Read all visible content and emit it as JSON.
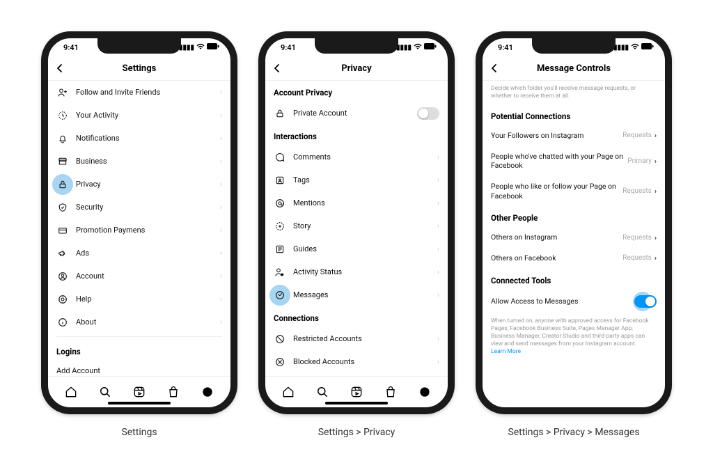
{
  "status": {
    "time": "9:41"
  },
  "phone1": {
    "title": "Settings",
    "items": [
      {
        "icon": "person-plus",
        "label": "Follow and Invite Friends"
      },
      {
        "icon": "clock",
        "label": "Your Activity"
      },
      {
        "icon": "bell",
        "label": "Notifications"
      },
      {
        "icon": "store",
        "label": "Business"
      },
      {
        "icon": "lock",
        "label": "Privacy",
        "highlight": true
      },
      {
        "icon": "shield",
        "label": "Security"
      },
      {
        "icon": "card",
        "label": "Promotion Paymens"
      },
      {
        "icon": "megaphone",
        "label": "Ads"
      },
      {
        "icon": "account",
        "label": "Account"
      },
      {
        "icon": "help",
        "label": "Help"
      },
      {
        "icon": "info",
        "label": "About"
      }
    ],
    "logins_header": "Logins",
    "add_account": "Add Account"
  },
  "phone2": {
    "title": "Privacy",
    "section1": "Account Privacy",
    "private_account": "Private Account",
    "section2": "Interactions",
    "items2": [
      {
        "icon": "comment",
        "label": "Comments"
      },
      {
        "icon": "tags",
        "label": "Tags"
      },
      {
        "icon": "mention",
        "label": "Mentions"
      },
      {
        "icon": "story",
        "label": "Story"
      },
      {
        "icon": "guides",
        "label": "Guides"
      },
      {
        "icon": "activity",
        "label": "Activity Status"
      },
      {
        "icon": "messages",
        "label": "Messages",
        "highlight": true
      }
    ],
    "section3": "Connections",
    "items3": [
      {
        "icon": "restricted",
        "label": "Restricted Accounts"
      },
      {
        "icon": "blocked",
        "label": "Blocked Accounts"
      }
    ]
  },
  "phone3": {
    "title": "Message Controls",
    "top_desc": "Decide which folder you'll receive message requests, or whether to receive them at all.",
    "sectionA": "Potential Connections",
    "rowsA": [
      {
        "label": "Your Followers on Instagram",
        "value": "Requests"
      },
      {
        "label": "People who've chatted with your Page on Facebook",
        "value": "Primary"
      },
      {
        "label": "People who like or follow your Page on Facebook",
        "value": "Requests"
      }
    ],
    "sectionB": "Other People",
    "rowsB": [
      {
        "label": "Others on Instagram",
        "value": "Requests"
      },
      {
        "label": "Others on Facebook",
        "value": "Requests"
      }
    ],
    "sectionC": "Connected Tools",
    "allow_access": "Allow Access to Messages",
    "footer": "When turned on, anyone with approved access for Facebook Pages, Facebook Business Suite, Pages Manager App, Business Manager, Creator Studio and third-party apps can view and send messages from your Instagram account.",
    "learn_more": "Learn More"
  },
  "captions": {
    "c1": "Settings",
    "c2": "Settings > Privacy",
    "c3": "Settings > Privacy > Messages"
  }
}
